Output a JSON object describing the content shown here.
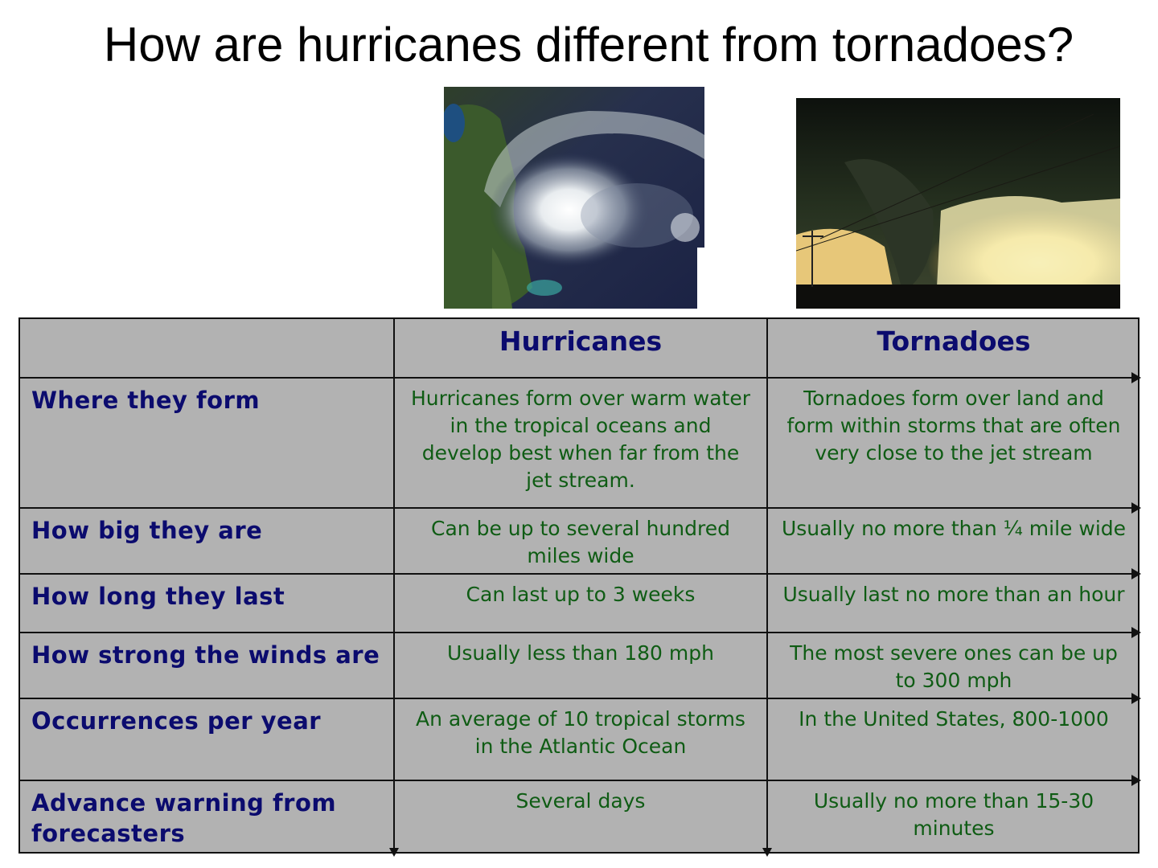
{
  "title": "How are hurricanes different from tornadoes?",
  "images": {
    "hurricane": "satellite-image-of-hurricane",
    "tornado": "photo-of-tornado"
  },
  "table": {
    "headers": [
      "",
      "Hurricanes",
      "Tornadoes"
    ],
    "rows": [
      {
        "label": "Where they form",
        "hurricanes": "Hurricanes form over warm water in the tropical oceans and develop best when far from the jet stream.",
        "tornadoes": "Tornadoes form over land and form within storms that are often very close to the jet stream"
      },
      {
        "label": "How big they are",
        "hurricanes": "Can be up to several hundred miles wide",
        "tornadoes": "Usually no more than ¼ mile wide"
      },
      {
        "label": "How long they last",
        "hurricanes": "Can last up to 3 weeks",
        "tornadoes": "Usually last no more than an hour"
      },
      {
        "label": "How strong the winds are",
        "hurricanes": "Usually less than 180 mph",
        "tornadoes": "The most severe ones can be up to 300 mph"
      },
      {
        "label": "Occurrences per year",
        "hurricanes": "An average of 10 tropical storms in the Atlantic Ocean",
        "tornadoes": "In the United States, 800-1000"
      },
      {
        "label": "Advance warning from forecasters",
        "hurricanes": "Several days",
        "tornadoes": "Usually no more than 15-30 minutes"
      }
    ]
  }
}
